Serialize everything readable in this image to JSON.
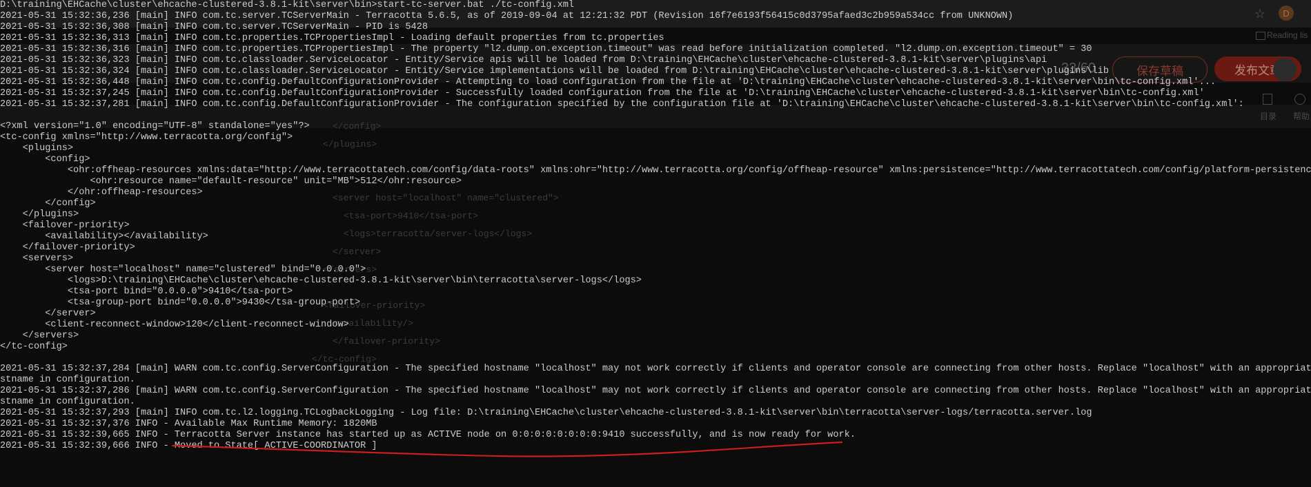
{
  "background_app": {
    "post_title_counter": "33/60",
    "save_draft_button": "保存草稿",
    "publish_button": "发布文章",
    "reading_list_label": "Reading lis",
    "catalog_label": "目录",
    "help_label": "帮助",
    "profile_initial": "D",
    "star_icon": "star-icon",
    "accent_color": "#c8432f"
  },
  "ghost_code": [
    "</config>",
    "</plugins>",
    "<server host=\"localhost\" name=\"clustered\">",
    "<tsa-port>9410</tsa-port>",
    "<logs>terracotta/server-logs</logs>",
    "</server>",
    "</servers>",
    "<failover-priority>",
    "<availability/>",
    "</failover-priority>",
    "</tc-config>"
  ],
  "console": {
    "lines": [
      "D:\\training\\EHCache\\cluster\\ehcache-clustered-3.8.1-kit\\server\\bin>start-tc-server.bat ./tc-config.xml",
      "2021-05-31 15:32:36,236 [main] INFO com.tc.server.TCServerMain - Terracotta 5.6.5, as of 2019-09-04 at 12:21:32 PDT (Revision 16f7e6193f56415c0d3795afaed3c2b959a534cc from UNKNOWN)",
      "2021-05-31 15:32:36,308 [main] INFO com.tc.server.TCServerMain - PID is 5428",
      "2021-05-31 15:32:36,313 [main] INFO com.tc.properties.TCPropertiesImpl - Loading default properties from tc.properties",
      "2021-05-31 15:32:36,316 [main] INFO com.tc.properties.TCPropertiesImpl - The property \"l2.dump.on.exception.timeout\" was read before initialization completed. \"l2.dump.on.exception.timeout\" = 30",
      "2021-05-31 15:32:36,323 [main] INFO com.tc.classloader.ServiceLocator - Entity/Service apis will be loaded from D:\\training\\EHCache\\cluster\\ehcache-clustered-3.8.1-kit\\server\\plugins\\api",
      "2021-05-31 15:32:36,324 [main] INFO com.tc.classloader.ServiceLocator - Entity/Service implementations will be loaded from D:\\training\\EHCache\\cluster\\ehcache-clustered-3.8.1-kit\\server\\plugins\\lib",
      "2021-05-31 15:32:36,448 [main] INFO com.tc.config.DefaultConfigurationProvider - Attempting to load configuration from the file at 'D:\\training\\EHCache\\cluster\\ehcache-clustered-3.8.1-kit\\server\\bin\\tc-config.xml'...",
      "2021-05-31 15:32:37,245 [main] INFO com.tc.config.DefaultConfigurationProvider - Successfully loaded configuration from the file at 'D:\\training\\EHCache\\cluster\\ehcache-clustered-3.8.1-kit\\server\\bin\\tc-config.xml'",
      "2021-05-31 15:32:37,281 [main] INFO com.tc.config.DefaultConfigurationProvider - The configuration specified by the configuration file at 'D:\\training\\EHCache\\cluster\\ehcache-clustered-3.8.1-kit\\server\\bin\\tc-config.xml':",
      "",
      "<?xml version=\"1.0\" encoding=\"UTF-8\" standalone=\"yes\"?>",
      "<tc-config xmlns=\"http://www.terracotta.org/config\">",
      "    <plugins>",
      "        <config>",
      "            <ohr:offheap-resources xmlns:data=\"http://www.terracottatech.com/config/data-roots\" xmlns:ohr=\"http://www.terracotta.org/config/offheap-resource\" xmlns:persistence=\"http://www.terracottatech.com/config/platform-persistence\">",
      "                <ohr:resource name=\"default-resource\" unit=\"MB\">512</ohr:resource>",
      "            </ohr:offheap-resources>",
      "        </config>",
      "    </plugins>",
      "    <failover-priority>",
      "        <availability></availability>",
      "    </failover-priority>",
      "    <servers>",
      "        <server host=\"localhost\" name=\"clustered\" bind=\"0.0.0.0\">",
      "            <logs>D:\\training\\EHCache\\cluster\\ehcache-clustered-3.8.1-kit\\server\\bin\\terracotta\\server-logs</logs>",
      "            <tsa-port bind=\"0.0.0.0\">9410</tsa-port>",
      "            <tsa-group-port bind=\"0.0.0.0\">9430</tsa-group-port>",
      "        </server>",
      "        <client-reconnect-window>120</client-reconnect-window>",
      "    </servers>",
      "</tc-config>",
      "",
      "2021-05-31 15:32:37,284 [main] WARN com.tc.config.ServerConfiguration - The specified hostname \"localhost\" may not work correctly if clients and operator console are connecting from other hosts. Replace \"localhost\" with an appropriate ho",
      "stname in configuration.",
      "2021-05-31 15:32:37,286 [main] WARN com.tc.config.ServerConfiguration - The specified hostname \"localhost\" may not work correctly if clients and operator console are connecting from other hosts. Replace \"localhost\" with an appropriate ho",
      "stname in configuration.",
      "2021-05-31 15:32:37,293 [main] INFO com.tc.l2.logging.TCLogbackLogging - Log file: D:\\training\\EHCache\\cluster\\ehcache-clustered-3.8.1-kit\\server\\bin\\terracotta\\server-logs/terracotta.server.log",
      "2021-05-31 15:32:37,376 INFO - Available Max Runtime Memory: 1820MB",
      "2021-05-31 15:32:39,665 INFO - Terracotta Server instance has started up as ACTIVE node on 0:0:0:0:0:0:0:0:9410 successfully, and is now ready for work.",
      "2021-05-31 15:32:39,666 INFO - Moved to State[ ACTIVE-COORDINATOR ]"
    ]
  },
  "annotation": {
    "underline_color": "#c81e1e"
  }
}
